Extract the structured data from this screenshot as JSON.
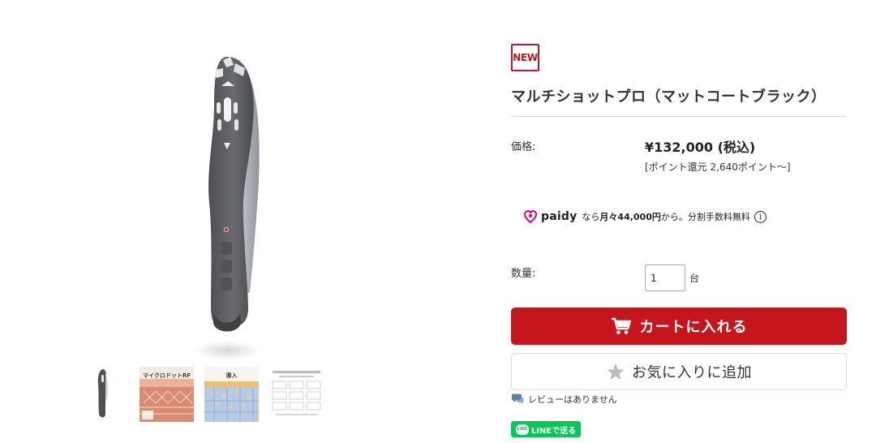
{
  "badge": {
    "label": "NEW"
  },
  "product": {
    "title": "マルチショットプロ（マットコートブラック）",
    "price_label": "価格:",
    "price": "¥132,000 (税込)",
    "points": "[ポイント還元 2,640ポイント〜]"
  },
  "paidy": {
    "logo_text": "paidy",
    "prefix": "なら",
    "amount": "月々44,000円",
    "suffix": "から。分割手数料無料",
    "info_icon": "i"
  },
  "quantity": {
    "label": "数量:",
    "value": "1",
    "unit": "台"
  },
  "cart_button": {
    "label": "カートに入れる",
    "icon": "cart-icon"
  },
  "favorite_button": {
    "label": "お気に入りに追加",
    "icon": "star-icon"
  },
  "review": {
    "text": "レビューはありません",
    "icon": "chat-bubble-icon"
  },
  "line_button": {
    "label": "LINEで送る",
    "icon_text": "LINE"
  },
  "thumbnails": [
    {
      "caption": ""
    },
    {
      "caption": "マイクロドットRF"
    },
    {
      "caption": "導入"
    },
    {
      "caption": ""
    }
  ],
  "colors": {
    "accent_red": "#c4161c",
    "line_green": "#06c755",
    "paidy_magenta": "#e1007e",
    "device_gray": "#5a5b5e"
  }
}
